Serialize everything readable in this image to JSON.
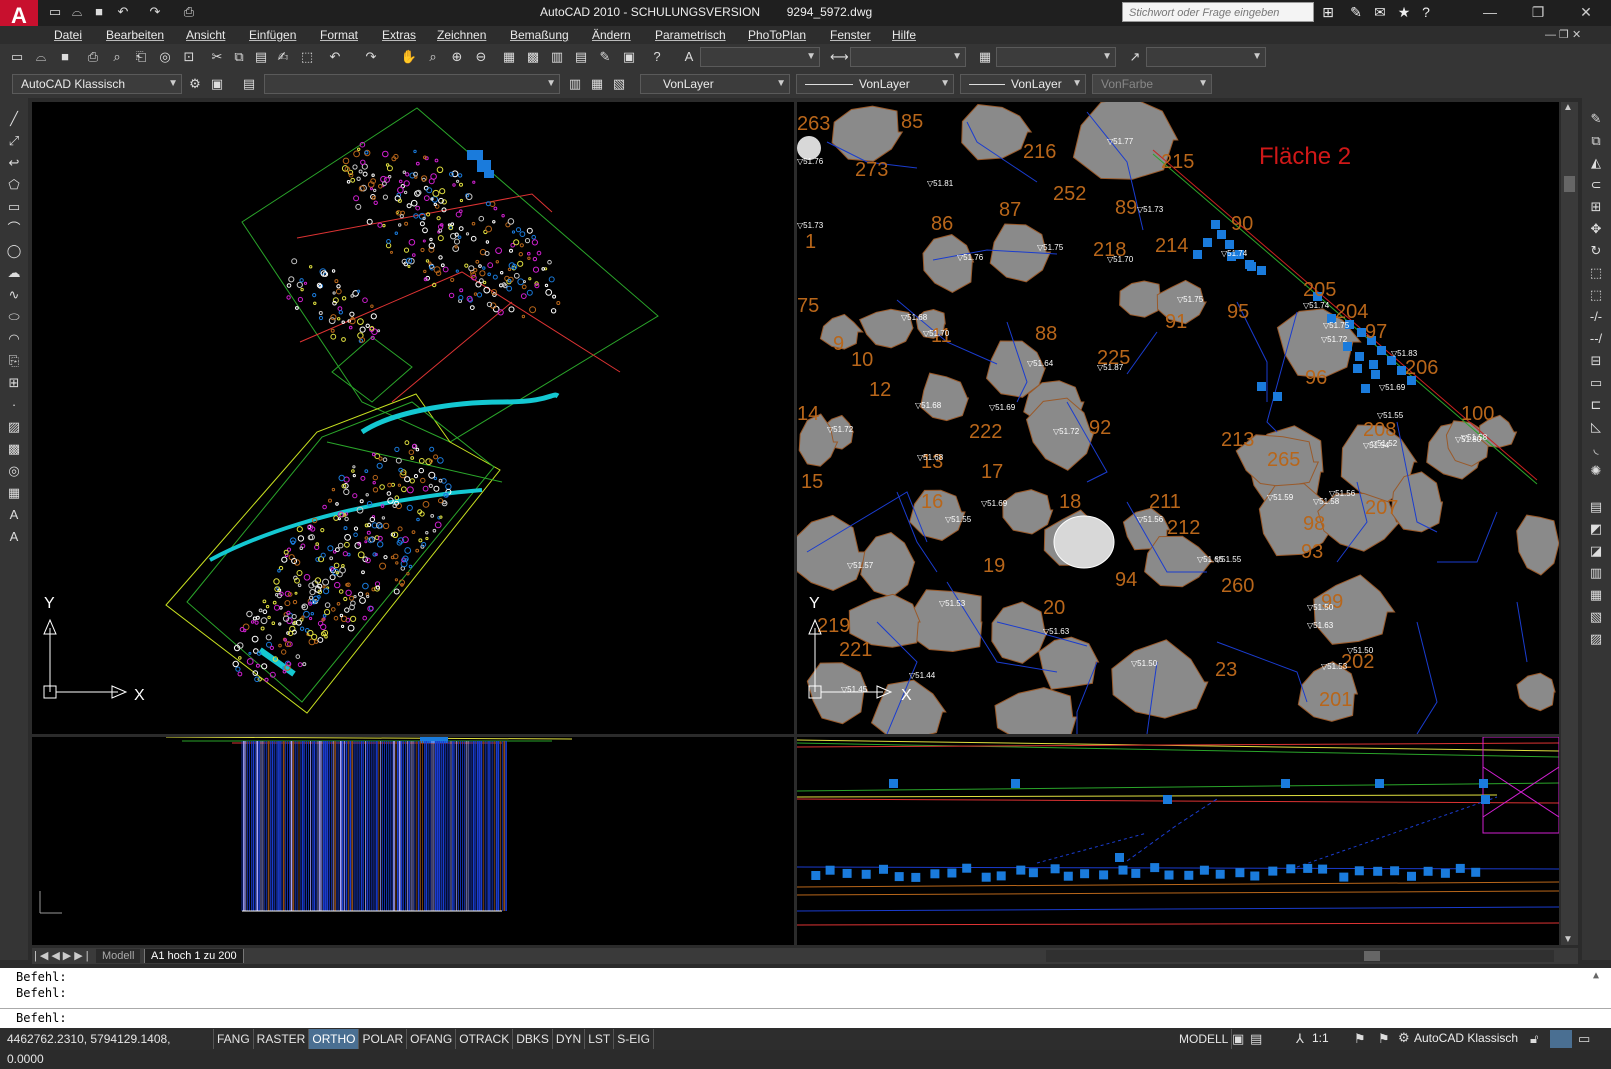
{
  "app": {
    "window_title": "AutoCAD 2010 - SCHULUNGSVERSION        9294_5972.dwg",
    "logo": "A",
    "search_placeholder": "Stichwort oder Frage eingeben"
  },
  "menu": [
    "Datei",
    "Bearbeiten",
    "Ansicht",
    "Einfügen",
    "Format",
    "Extras",
    "Zeichnen",
    "Bemaßung",
    "Ändern",
    "Parametrisch",
    "PhoToPlan",
    "Fenster",
    "Hilfe"
  ],
  "toolbar2": {
    "workspace": "AutoCAD Klassisch",
    "color": "VonLayer",
    "linetype": "VonLayer",
    "lineweight": "VonLayer",
    "plotstyle": "VonFarbe"
  },
  "detail_view": {
    "area_label": "Fläche 2",
    "feature_numbers": [
      {
        "t": "263",
        "c": "orange"
      },
      {
        "t": "85",
        "c": "orange"
      },
      {
        "t": "273",
        "c": "orange"
      },
      {
        "t": "216",
        "c": "orange"
      },
      {
        "t": "215",
        "c": "orange"
      },
      {
        "t": "252",
        "c": "orange"
      },
      {
        "t": "89",
        "c": "orange"
      },
      {
        "t": "90",
        "c": "orange"
      },
      {
        "t": "86",
        "c": "orange"
      },
      {
        "t": "87",
        "c": "orange"
      },
      {
        "t": "218",
        "c": "orange"
      },
      {
        "t": "214",
        "c": "orange"
      },
      {
        "t": "1",
        "c": "orange"
      },
      {
        "t": "205",
        "c": "orange"
      },
      {
        "t": "204",
        "c": "orange"
      },
      {
        "t": "97",
        "c": "orange"
      },
      {
        "t": "95",
        "c": "orange"
      },
      {
        "t": "91",
        "c": "orange"
      },
      {
        "t": "75",
        "c": "orange"
      },
      {
        "t": "9",
        "c": "orange"
      },
      {
        "t": "11",
        "c": "orange"
      },
      {
        "t": "88",
        "c": "orange"
      },
      {
        "t": "225",
        "c": "orange"
      },
      {
        "t": "206",
        "c": "orange"
      },
      {
        "t": "96",
        "c": "orange"
      },
      {
        "t": "10",
        "c": "orange"
      },
      {
        "t": "12",
        "c": "orange"
      },
      {
        "t": "100",
        "c": "orange"
      },
      {
        "t": "14",
        "c": "orange"
      },
      {
        "t": "222",
        "c": "orange"
      },
      {
        "t": "92",
        "c": "orange"
      },
      {
        "t": "208",
        "c": "orange"
      },
      {
        "t": "213",
        "c": "orange"
      },
      {
        "t": "13",
        "c": "orange"
      },
      {
        "t": "17",
        "c": "orange"
      },
      {
        "t": "265",
        "c": "orange"
      },
      {
        "t": "15",
        "c": "orange"
      },
      {
        "t": "16",
        "c": "orange"
      },
      {
        "t": "18",
        "c": "orange"
      },
      {
        "t": "211",
        "c": "orange"
      },
      {
        "t": "207",
        "c": "orange"
      },
      {
        "t": "212",
        "c": "orange"
      },
      {
        "t": "98",
        "c": "orange"
      },
      {
        "t": "19",
        "c": "orange"
      },
      {
        "t": "94",
        "c": "orange"
      },
      {
        "t": "260",
        "c": "orange"
      },
      {
        "t": "93",
        "c": "orange"
      },
      {
        "t": "99",
        "c": "orange"
      },
      {
        "t": "219",
        "c": "orange"
      },
      {
        "t": "20",
        "c": "orange"
      },
      {
        "t": "221",
        "c": "orange"
      },
      {
        "t": "23",
        "c": "orange"
      },
      {
        "t": "202",
        "c": "orange"
      },
      {
        "t": "201",
        "c": "orange"
      }
    ],
    "elevations": [
      "51.76",
      "51.81",
      "51.77",
      "51.73",
      "51.73",
      "51.76",
      "51.75",
      "51.70",
      "51.74",
      "51.75",
      "51.68",
      "51.70",
      "51.87",
      "51.74",
      "51.75",
      "51.64",
      "51.72",
      "51.83",
      "51.69",
      "51.69",
      "51.72",
      "51.68",
      "51.72",
      "51.55",
      "51.52",
      "51.54",
      "51.58",
      "51.68",
      "51.59",
      "51.56",
      "51.55",
      "51.69",
      "51.56",
      "51.65",
      "51.55",
      "51.57",
      "51.53",
      "51.63",
      "51.50",
      "51.63",
      "51.50",
      "51.53",
      "51.50",
      "51.45",
      "51.44",
      "51.80",
      "51.58"
    ]
  },
  "layout_tabs": [
    "Modell",
    "A1 hoch 1 zu 200"
  ],
  "command": {
    "history": [
      "Befehl:",
      "Befehl:"
    ],
    "prompt": "Befehl:"
  },
  "status": {
    "coords": "4462762.2310, 5794129.1408, 0.0000",
    "toggles": [
      {
        "label": "FANG",
        "on": false
      },
      {
        "label": "RASTER",
        "on": false
      },
      {
        "label": "ORTHO",
        "on": true
      },
      {
        "label": "POLAR",
        "on": false
      },
      {
        "label": "OFANG",
        "on": false
      },
      {
        "label": "OTRACK",
        "on": false
      },
      {
        "label": "DBKS",
        "on": false
      },
      {
        "label": "DYN",
        "on": false
      },
      {
        "label": "LST",
        "on": false
      },
      {
        "label": "S-EIG",
        "on": false
      }
    ],
    "model": "MODELL",
    "scale": "1:1",
    "workspace": "AutoCAD Klassisch"
  },
  "colors": {
    "accent": "#c8102e",
    "orange": "#b8661a",
    "blue_marker": "#1a7bdc",
    "polyline_blue": "#1a3ccf"
  }
}
